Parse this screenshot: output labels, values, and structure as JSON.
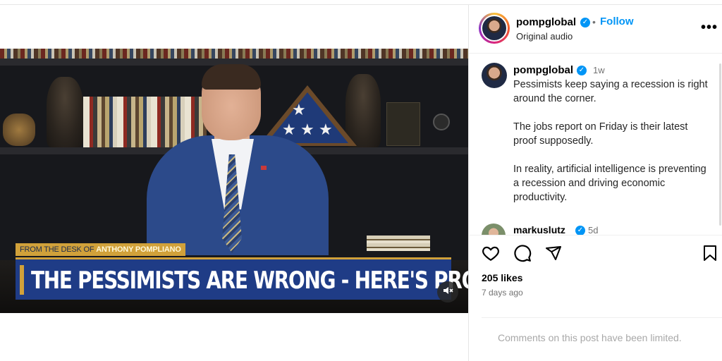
{
  "video": {
    "banner_kicker_prefix": "FROM THE DESK OF",
    "banner_kicker_name": "ANTHONY POMPLIANO",
    "banner_title": "THE PESSIMISTS ARE WRONG - HERE'S PROOF.",
    "mute_icon": "speaker-muted-icon"
  },
  "header": {
    "username": "pompglobal",
    "follow_label": "Follow",
    "audio_label": "Original audio",
    "more_label": "•••"
  },
  "caption": {
    "username": "pompglobal",
    "time": "1w",
    "paragraphs": [
      "Pessimists keep saying a recession is right around the corner.",
      "The jobs report on Friday is their latest proof supposedly.",
      "In reality, artificial intelligence is preventing a recession and driving economic productivity."
    ]
  },
  "comment": {
    "username": "markuslutz",
    "time": "5d"
  },
  "actions": {
    "icons": [
      "heart-icon",
      "comment-icon",
      "share-icon",
      "bookmark-icon"
    ]
  },
  "stats": {
    "likes": "205 likes",
    "posted": "7 days ago"
  },
  "comments_limited": "Comments on this post have been limited.",
  "colors": {
    "accent": "#0095f6",
    "banner_blue": "#1f3c86",
    "banner_gold": "#d1a13a"
  }
}
